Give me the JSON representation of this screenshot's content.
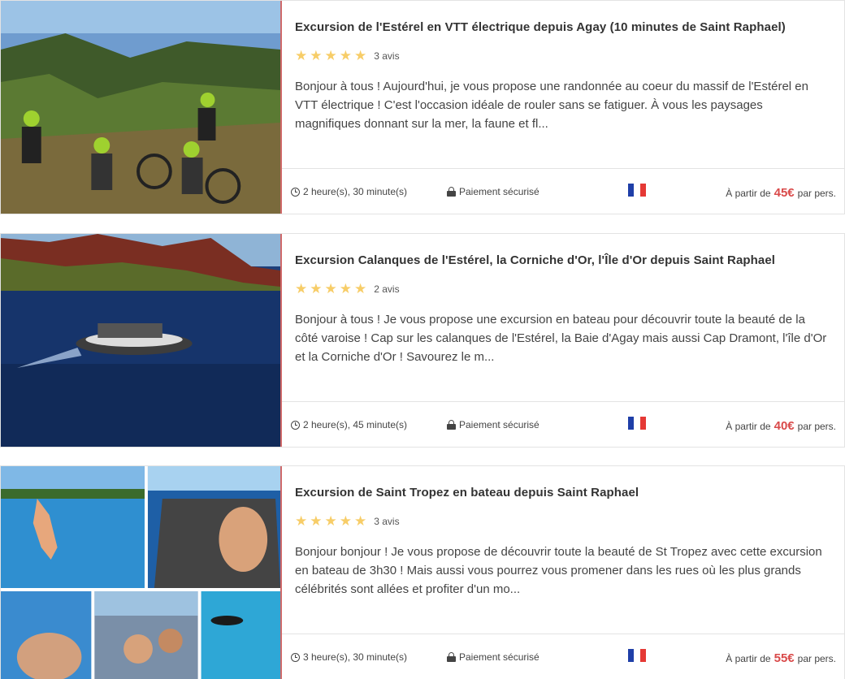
{
  "excursions": [
    {
      "title": "Excursion de l'Estérel en VTT électrique depuis Agay (10 minutes de Saint Raphael)",
      "rating": 5,
      "reviews": "3 avis",
      "description": "Bonjour à tous ! Aujourd'hui, je vous propose une randonnée au coeur du massif de l'Estérel en VTT électrique ! C'est l'occasion idéale de rouler sans se fatiguer. À vous les paysages magnifiques donnant sur la mer, la faune et fl...",
      "duration": "2 heure(s), 30 minute(s)",
      "payment": "Paiement sécurisé",
      "price_prefix": "À partir de",
      "price": "45€",
      "price_suffix": "par pers."
    },
    {
      "title": "Excursion Calanques de l'Estérel, la Corniche d'Or, l'Île d'Or depuis Saint Raphael",
      "rating": 5,
      "reviews": "2 avis",
      "description": "Bonjour à tous ! Je vous propose une excursion en bateau pour découvrir toute la beauté de la côté varoise ! Cap sur les calanques de l'Estérel, la Baie d'Agay mais aussi Cap Dramont, l'île d'Or et la Corniche d'Or ! Savourez le m...",
      "duration": "2 heure(s), 45 minute(s)",
      "payment": "Paiement sécurisé",
      "price_prefix": "À partir de",
      "price": "40€",
      "price_suffix": "par pers."
    },
    {
      "title": "Excursion de Saint Tropez en bateau depuis Saint Raphael",
      "rating": 5,
      "reviews": "3 avis",
      "description": "Bonjour bonjour ! Je vous propose de découvrir toute la beauté de St Tropez avec cette excursion en bateau de 3h30 ! Mais aussi vous pourrez vous promener dans les rues où les plus grands célébrités sont allées et profiter d'un mo...",
      "duration": "3 heure(s), 30 minute(s)",
      "payment": "Paiement sécurisé",
      "price_prefix": "À partir de",
      "price": "55€",
      "price_suffix": "par pers."
    }
  ],
  "colors": {
    "star": "#f7cd68",
    "price": "#d94a4a",
    "accent_border": "#d06a6a"
  },
  "icons": {
    "duration": "clock-icon",
    "payment": "lock-icon",
    "language": "flag-france-icon",
    "rating": "star-icon"
  }
}
